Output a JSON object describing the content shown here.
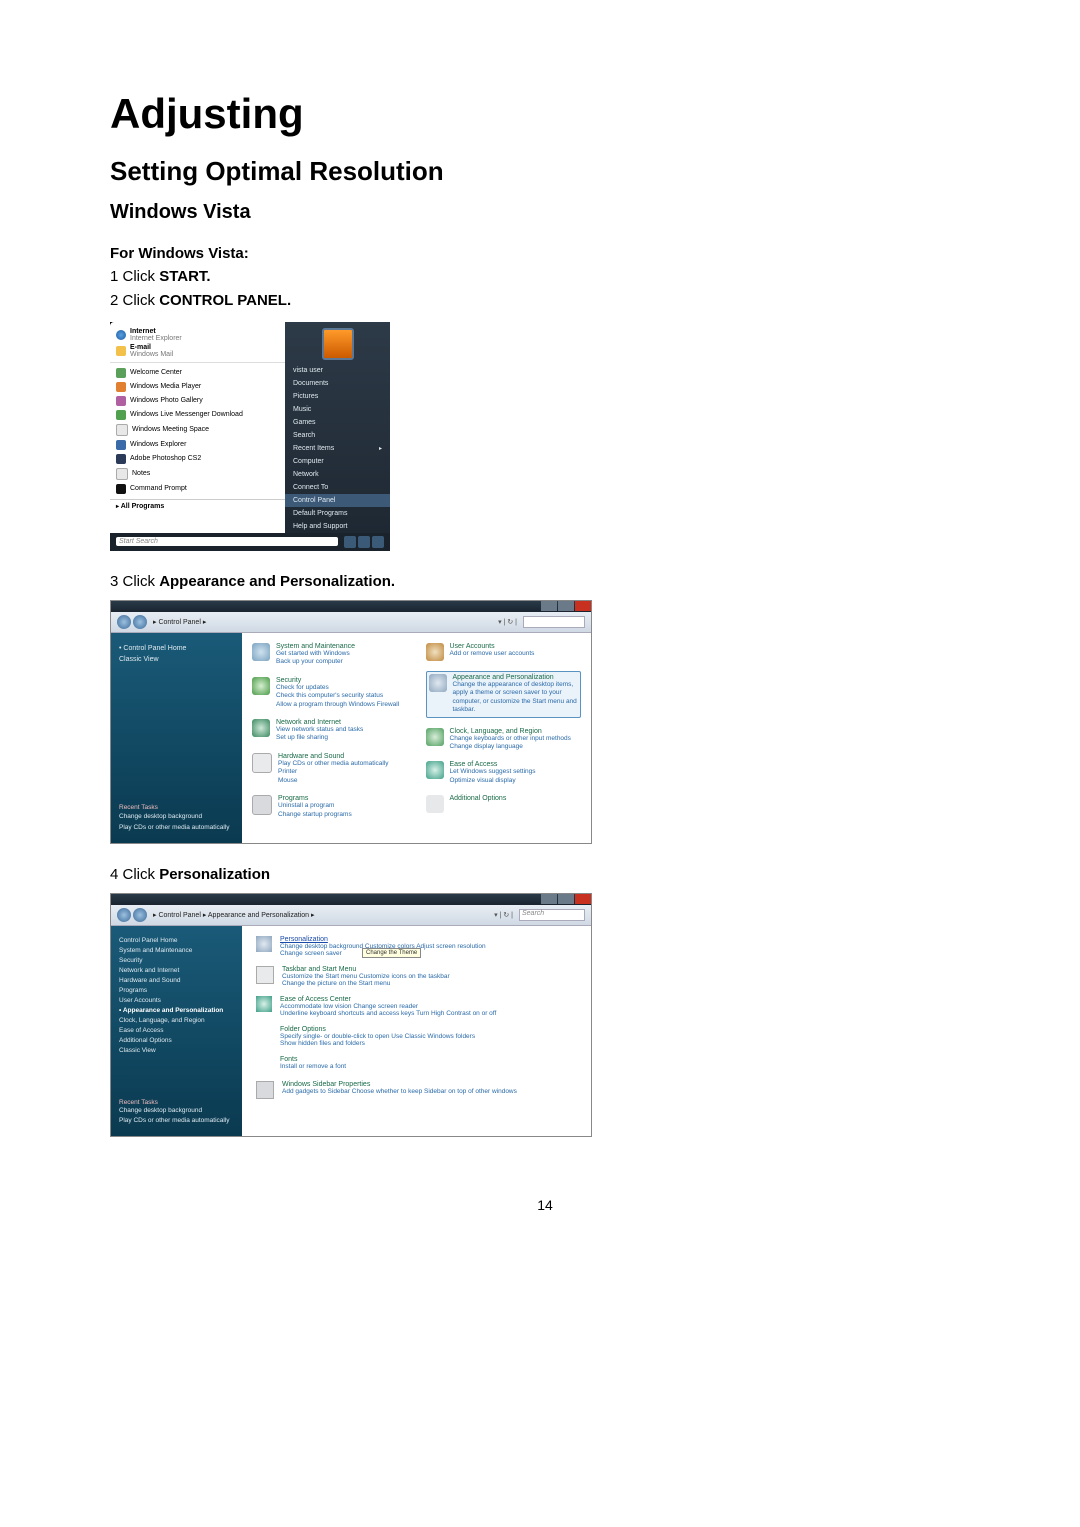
{
  "page_number": "14",
  "h1": "Adjusting",
  "h2": "Setting Optimal Resolution",
  "h3": "Windows Vista",
  "intro_lead": "For Windows Vista:",
  "step1_pre": "1 Click ",
  "step1_bold": "START.",
  "step2_pre": "2 Click ",
  "step2_bold": "CONTROL PANEL.",
  "step3_pre": "3 Click ",
  "step3_bold": "Appearance and Personalization.",
  "step4_pre": "4 Click ",
  "step4_bold": "Personalization",
  "startmenu": {
    "pinned": [
      {
        "label": "Internet",
        "sub": "Internet Explorer",
        "icon": "globe"
      },
      {
        "label": "E-mail",
        "sub": "Windows Mail",
        "icon": "mail"
      }
    ],
    "recent": [
      {
        "label": "Welcome Center",
        "icon": "green"
      },
      {
        "label": "Windows Media Player",
        "icon": "orange"
      },
      {
        "label": "Windows Photo Gallery",
        "icon": "photo"
      },
      {
        "label": "Windows Live Messenger Download",
        "icon": "msn"
      },
      {
        "label": "Windows Meeting Space",
        "icon": "note"
      },
      {
        "label": "Windows Explorer",
        "icon": "blue"
      },
      {
        "label": "Adobe Photoshop CS2",
        "icon": "ps"
      },
      {
        "label": "Notes",
        "icon": "note"
      },
      {
        "label": "Command Prompt",
        "icon": "dos"
      }
    ],
    "all_programs": "All Programs",
    "search_placeholder": "Start Search",
    "right": [
      "",
      "Documents",
      "Pictures",
      "Music",
      "Games",
      "Search",
      "Recent Items",
      "Computer",
      "Network",
      "Connect To",
      "Control Panel",
      "Default Programs",
      "Help and Support"
    ],
    "right_top_user": "vista user",
    "highlighted": "Control Panel"
  },
  "cp_home": {
    "breadcrumb": "▸ Control Panel ▸",
    "pager": "▾ | ↻ |",
    "sidebar": {
      "heading": "Control Panel Home",
      "classic": "Classic View",
      "recent_heading": "Recent Tasks",
      "recent1": "Change desktop background",
      "recent2": "Play CDs or other media automatically"
    },
    "left_col": [
      {
        "title": "System and Maintenance",
        "sub": "Get started with Windows\nBack up your computer",
        "icon": "sys"
      },
      {
        "title": "Security",
        "sub": "Check for updates\nCheck this computer's security status\nAllow a program through Windows Firewall",
        "icon": "sec"
      },
      {
        "title": "Network and Internet",
        "sub": "View network status and tasks\nSet up file sharing",
        "icon": "net"
      },
      {
        "title": "Hardware and Sound",
        "sub": "Play CDs or other media automatically\nPrinter\nMouse",
        "icon": "hw"
      },
      {
        "title": "Programs",
        "sub": "Uninstall a program\nChange startup programs",
        "icon": "prg"
      }
    ],
    "right_col": [
      {
        "title": "User Accounts",
        "sub": "Add or remove user accounts",
        "icon": "usr"
      },
      {
        "title": "Appearance and Personalization",
        "sub": "Change the appearance of desktop items, apply a theme or screen saver to your computer, or customize the Start menu and taskbar.",
        "icon": "app",
        "highlight": true
      },
      {
        "title": "Clock, Language, and Region",
        "sub": "Change keyboards or other input methods\nChange display language",
        "icon": "clk"
      },
      {
        "title": "Ease of Access",
        "sub": "Let Windows suggest settings\nOptimize visual display",
        "icon": "eoa"
      },
      {
        "title": "Additional Options",
        "sub": "",
        "icon": "add"
      }
    ]
  },
  "ap_panel": {
    "breadcrumb": "▸ Control Panel ▸ Appearance and Personalization ▸",
    "search_placeholder": "Search",
    "sidebar": [
      "Control Panel Home",
      "System and Maintenance",
      "Security",
      "Network and Internet",
      "Hardware and Sound",
      "Programs",
      "User Accounts",
      "Appearance and Personalization",
      "Clock, Language, and Region",
      "Ease of Access",
      "Additional Options",
      "Classic View"
    ],
    "sidebar_active": "Appearance and Personalization",
    "recent_heading": "Recent Tasks",
    "recent1": "Change desktop background",
    "recent2": "Play CDs or other media automatically",
    "items": [
      {
        "title": "Personalization",
        "hl": true,
        "sub": "Change desktop background   Customize colors   Adjust screen resolution\nChange screen saver",
        "tooltip": "Change the Theme"
      },
      {
        "title": "Taskbar and Start Menu",
        "sub": "Customize the Start menu   Customize icons on the taskbar\nChange the picture on the Start menu"
      },
      {
        "title": "Ease of Access Center",
        "sub": "Accommodate low vision   Change screen reader\nUnderline keyboard shortcuts and access keys   Turn High Contrast on or off"
      },
      {
        "title": "Folder Options",
        "sub": "Specify single- or double-click to open   Use Classic Windows folders\nShow hidden files and folders"
      },
      {
        "title": "Fonts",
        "sub": "Install or remove a font"
      },
      {
        "title": "Windows Sidebar Properties",
        "sub": "Add gadgets to Sidebar   Choose whether to keep Sidebar on top of other windows"
      }
    ]
  }
}
